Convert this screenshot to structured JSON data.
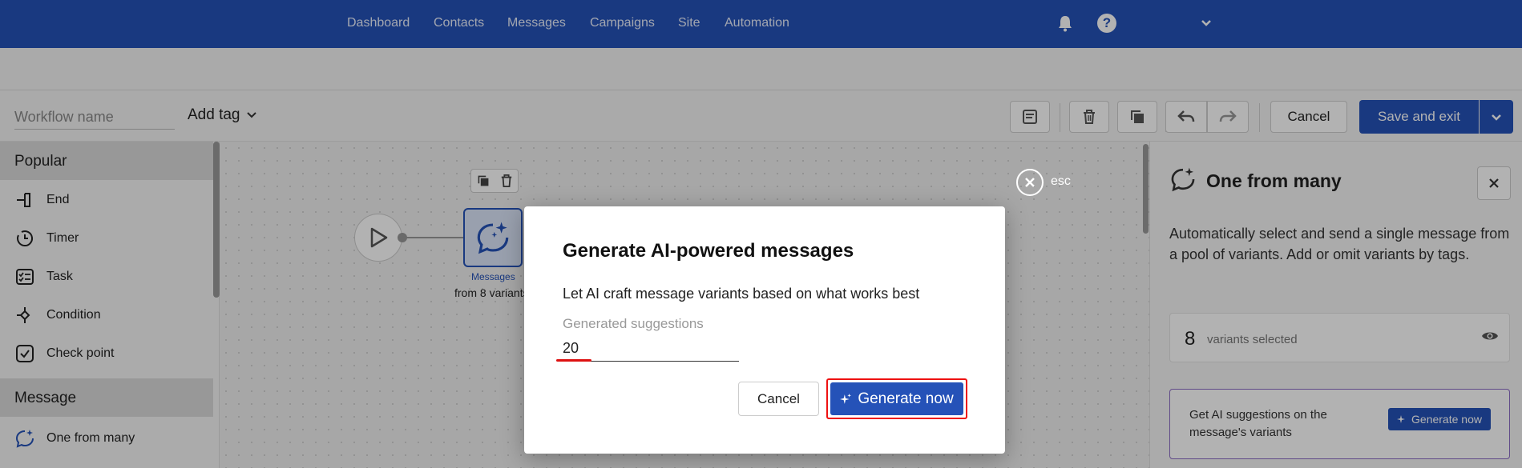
{
  "nav": {
    "items": [
      "Dashboard",
      "Contacts",
      "Messages",
      "Campaigns",
      "Site",
      "Automation"
    ],
    "icons": [
      "bell-icon",
      "help-icon",
      "chevron-down-icon"
    ],
    "help_glyph": "?"
  },
  "toolbar": {
    "workflow_name_placeholder": "Workflow name",
    "add_tag_label": "Add tag",
    "cancel_label": "Cancel",
    "save_label": "Save and exit"
  },
  "sidebar": {
    "sections": [
      {
        "title": "Popular",
        "items": [
          "End",
          "Timer",
          "Task",
          "Condition",
          "Check point"
        ]
      },
      {
        "title": "Message",
        "items": [
          "One from many"
        ]
      }
    ]
  },
  "canvas": {
    "node_label": "Messages",
    "node_sub": "from 8 variants",
    "esc_label": "esc"
  },
  "panel": {
    "title": "One from many",
    "description": "Automatically select and send a single message from a pool of variants. Add or omit variants by tags.",
    "variant_count": "8",
    "variant_label": "variants selected",
    "ai_text": "Get AI suggestions on the message's variants",
    "ai_button": "Generate now"
  },
  "modal": {
    "title": "Generate AI-powered messages",
    "description": "Let AI craft message variants based on what works best",
    "field_label": "Generated suggestions",
    "field_value": "20",
    "cancel_label": "Cancel",
    "generate_label": "Generate now"
  },
  "colors": {
    "brand": "#2552b8",
    "highlight": "#e11111"
  }
}
